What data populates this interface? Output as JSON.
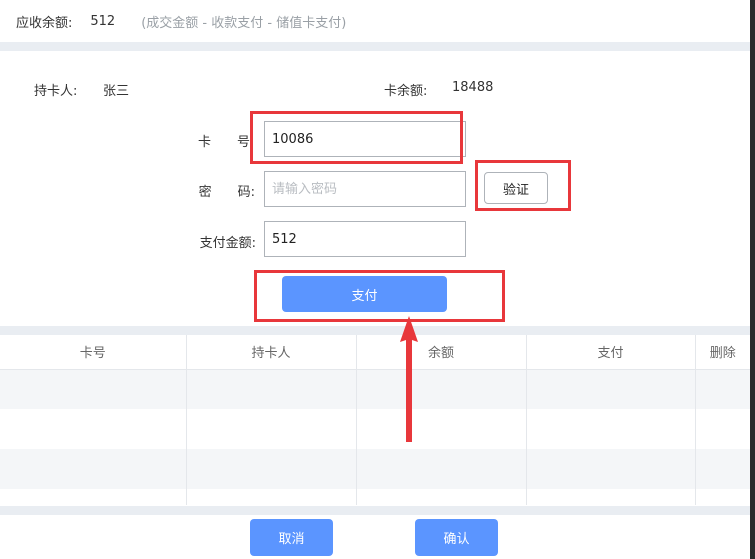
{
  "header": {
    "receivable_label": "应收余额:",
    "receivable_amount": "512",
    "hint": "(成交金额 - 收款支付 - 储值卡支付)"
  },
  "card_info": {
    "holder_label": "持卡人:",
    "holder_name": "张三",
    "balance_label": "卡余额:",
    "balance_value": "18488"
  },
  "form": {
    "card_no_label": "卡　　号",
    "card_no_value": "10086",
    "password_label": "密　　码:",
    "password_placeholder": "请输入密码",
    "pay_amount_label": "支付金额:",
    "pay_amount_value": "512",
    "verify_label": "验证",
    "pay_label": "支付"
  },
  "table": {
    "columns": [
      "卡号",
      "持卡人",
      "余额",
      "支付",
      "删除"
    ],
    "rows": [
      [
        "",
        "",
        "",
        "",
        ""
      ],
      [
        "",
        "",
        "",
        "",
        ""
      ],
      [
        "",
        "",
        "",
        "",
        ""
      ],
      [
        "",
        "",
        "",
        "",
        ""
      ]
    ]
  },
  "footer": {
    "cancel_label": "取消",
    "confirm_label": "确认"
  },
  "colors": {
    "primary": "#5b95ff",
    "annotation_red": "#e8373b",
    "separator": "#e9edf2"
  }
}
